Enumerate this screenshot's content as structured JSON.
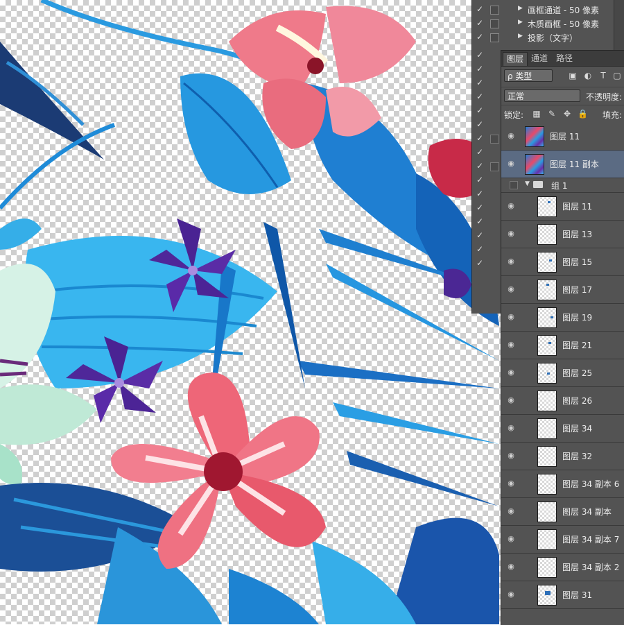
{
  "styles_panel": {
    "rows": [
      {
        "label": "画框通道 - 50 像素",
        "checked": true
      },
      {
        "label": "木质画框 - 50 像素",
        "checked": true
      },
      {
        "label": "投影（文字）",
        "checked": true
      }
    ]
  },
  "layers_panel": {
    "tabs": [
      "图层",
      "通道",
      "路径"
    ],
    "filter_kind": "ρ 类型",
    "blend_mode": "正常",
    "opacity_label": "不透明度:",
    "lock_label": "锁定:",
    "fill_label": "填充:",
    "layers": [
      {
        "name": "图层 11",
        "visible": true,
        "selected": false
      },
      {
        "name": "图层 11 副本",
        "visible": true,
        "selected": true
      }
    ],
    "group": {
      "name": "组 1",
      "expanded": true
    },
    "group_layers": [
      {
        "name": "图层 11"
      },
      {
        "name": "图层 13"
      },
      {
        "name": "图层 15"
      },
      {
        "name": "图层 17"
      },
      {
        "name": "图层 19"
      },
      {
        "name": "图层 21"
      },
      {
        "name": "图层 25"
      },
      {
        "name": "图层 26"
      },
      {
        "name": "图层 34"
      },
      {
        "name": "图层 32"
      },
      {
        "name": "图层 34 副本 6"
      },
      {
        "name": "图层 34 副本"
      },
      {
        "name": "图层 34 副本 7"
      },
      {
        "name": "图层 34 副本 2"
      },
      {
        "name": "图层 31"
      }
    ]
  },
  "colors": {
    "panel_bg": "#535353",
    "selected_row": "#5b6b83",
    "hibiscus": "#e85a6e",
    "leaf_blue": "#1e88d8",
    "violet": "#5a2a9e"
  }
}
